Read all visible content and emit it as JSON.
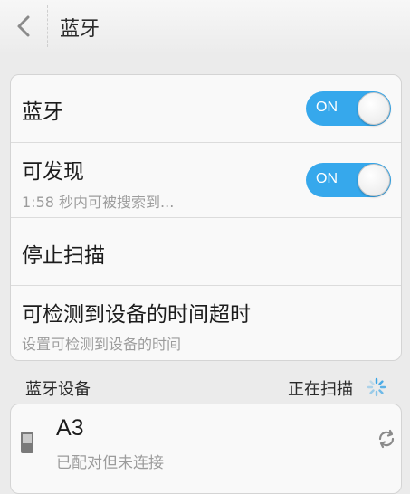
{
  "header": {
    "title": "蓝牙"
  },
  "settings": [
    {
      "title": "蓝牙",
      "toggle": "ON"
    },
    {
      "title": "可发现",
      "subtitle": "1:58 秒内可被搜索到...",
      "toggle": "ON"
    },
    {
      "title": "停止扫描"
    },
    {
      "title": "可检测到设备的时间超时",
      "subtitle": "设置可检测到设备的时间"
    }
  ],
  "devices_section": {
    "title": "蓝牙设备",
    "status": "正在扫描"
  },
  "devices": [
    {
      "name": "A3",
      "status": "已配对但未连接",
      "icon": "phone-icon",
      "action_icon": "refresh-icon"
    }
  ],
  "colors": {
    "accent": "#36a8ec",
    "background": "#ebebeb",
    "card": "#f9f9f9"
  }
}
